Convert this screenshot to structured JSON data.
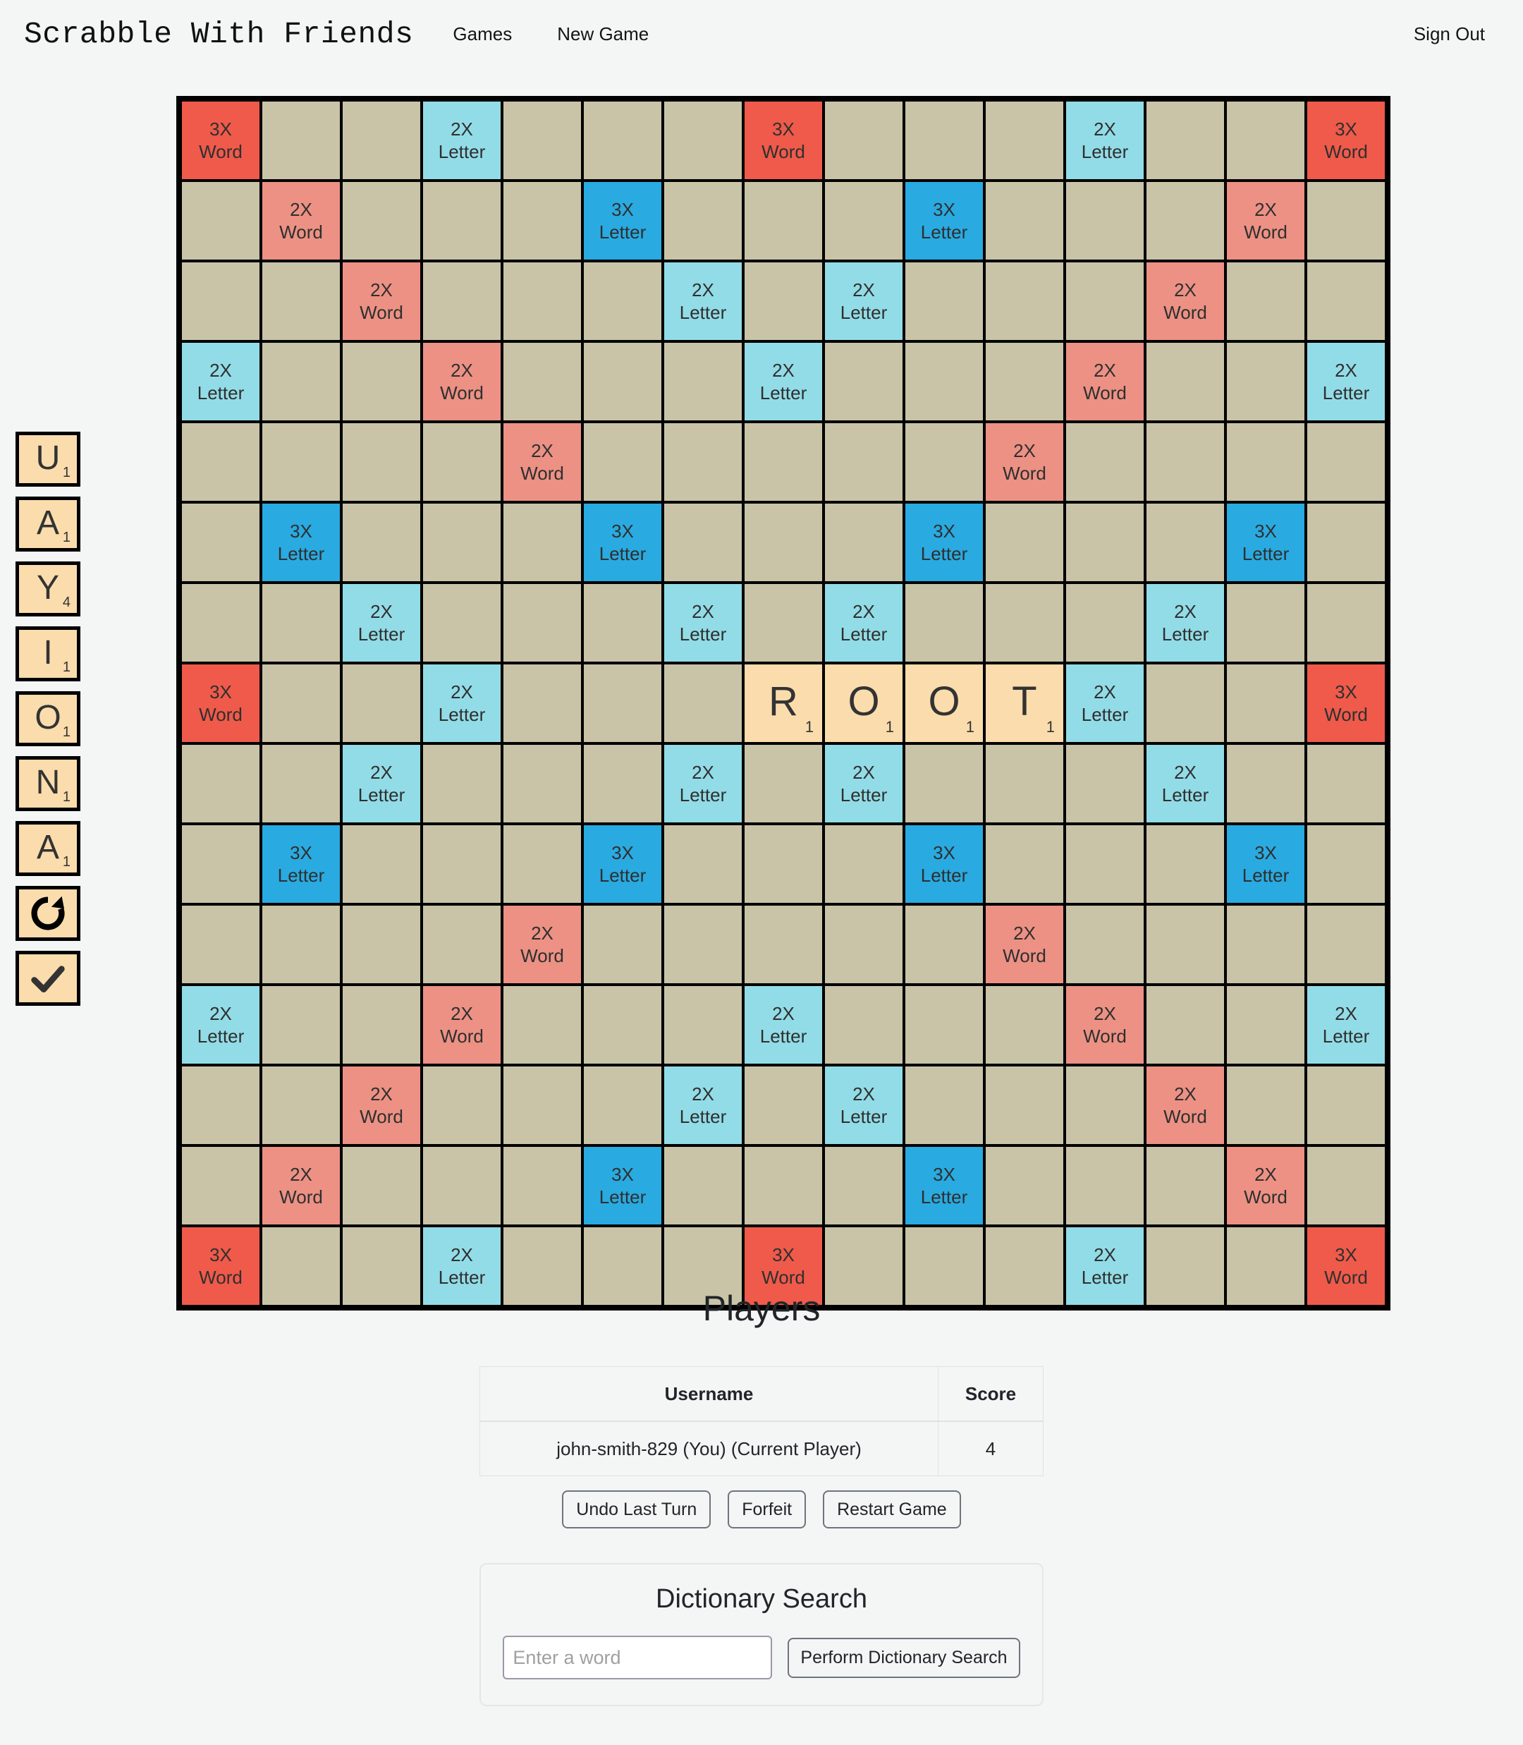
{
  "header": {
    "brand": "Scrabble With Friends",
    "nav": [
      {
        "label": "Games"
      },
      {
        "label": "New Game"
      }
    ],
    "sign_out": "Sign Out"
  },
  "colors": {
    "page_bg": "#f4f5f5",
    "board_grid": "#000000",
    "cell_normal": "#c9c4a8",
    "triple_word": "#ef5a4a",
    "double_word": "#ec9184",
    "triple_letter": "#29aae1",
    "double_letter": "#92dce7",
    "tile": "#fbdcac",
    "tile_text": "#333333"
  },
  "bonus_labels": {
    "tw": {
      "top": "3X",
      "bottom": "Word"
    },
    "dw": {
      "top": "2X",
      "bottom": "Word"
    },
    "tl": {
      "top": "3X",
      "bottom": "Letter"
    },
    "dl": {
      "top": "2X",
      "bottom": "Letter"
    }
  },
  "rack": {
    "tiles": [
      {
        "letter": "U",
        "value": "1"
      },
      {
        "letter": "A",
        "value": "1"
      },
      {
        "letter": "Y",
        "value": "4"
      },
      {
        "letter": "I",
        "value": "1"
      },
      {
        "letter": "O",
        "value": "1"
      },
      {
        "letter": "N",
        "value": "1"
      },
      {
        "letter": "A",
        "value": "1"
      }
    ],
    "actions": [
      {
        "icon": "refresh-icon",
        "name": "shuffle-tiles-button"
      },
      {
        "icon": "check-icon",
        "name": "submit-move-button"
      }
    ]
  },
  "board": {
    "size": 15,
    "cells": [
      [
        "tw",
        "",
        "",
        "dl",
        "",
        "",
        "",
        "tw",
        "",
        "",
        "",
        "dl",
        "",
        "",
        "tw"
      ],
      [
        "",
        "dw",
        "",
        "",
        "",
        "tl",
        "",
        "",
        "",
        "tl",
        "",
        "",
        "",
        "dw",
        ""
      ],
      [
        "",
        "",
        "dw",
        "",
        "",
        "",
        "dl",
        "",
        "dl",
        "",
        "",
        "",
        "dw",
        "",
        ""
      ],
      [
        "dl",
        "",
        "",
        "dw",
        "",
        "",
        "",
        "dl",
        "",
        "",
        "",
        "dw",
        "",
        "",
        "dl"
      ],
      [
        "",
        "",
        "",
        "",
        "dw",
        "",
        "",
        "",
        "",
        "",
        "dw",
        "",
        "",
        "",
        ""
      ],
      [
        "",
        "tl",
        "",
        "",
        "",
        "tl",
        "",
        "",
        "",
        "tl",
        "",
        "",
        "",
        "tl",
        ""
      ],
      [
        "",
        "",
        "dl",
        "",
        "",
        "",
        "dl",
        "",
        "dl",
        "",
        "",
        "",
        "dl",
        "",
        ""
      ],
      [
        "tw",
        "",
        "",
        "dl",
        "",
        "",
        "",
        "T:R:1",
        "T:O:1",
        "T:O:1",
        "T:T:1",
        "dl",
        "",
        "",
        "tw"
      ],
      [
        "",
        "",
        "dl",
        "",
        "",
        "",
        "dl",
        "",
        "dl",
        "",
        "",
        "",
        "dl",
        "",
        ""
      ],
      [
        "",
        "tl",
        "",
        "",
        "",
        "tl",
        "",
        "",
        "",
        "tl",
        "",
        "",
        "",
        "tl",
        ""
      ],
      [
        "",
        "",
        "",
        "",
        "dw",
        "",
        "",
        "",
        "",
        "",
        "dw",
        "",
        "",
        "",
        ""
      ],
      [
        "dl",
        "",
        "",
        "dw",
        "",
        "",
        "",
        "dl",
        "",
        "",
        "",
        "dw",
        "",
        "",
        "dl"
      ],
      [
        "",
        "",
        "dw",
        "",
        "",
        "",
        "dl",
        "",
        "dl",
        "",
        "",
        "",
        "dw",
        "",
        ""
      ],
      [
        "",
        "dw",
        "",
        "",
        "",
        "tl",
        "",
        "",
        "",
        "tl",
        "",
        "",
        "",
        "dw",
        ""
      ],
      [
        "tw",
        "",
        "",
        "dl",
        "",
        "",
        "",
        "tw",
        "",
        "",
        "",
        "dl",
        "",
        "",
        "tw"
      ]
    ],
    "placed_word": "ROOT"
  },
  "players": {
    "title": "Players",
    "columns": [
      "Username",
      "Score"
    ],
    "rows": [
      {
        "username": "john-smith-829 (You) (Current Player)",
        "score": "4"
      }
    ]
  },
  "game_actions": [
    {
      "label": "Undo Last Turn"
    },
    {
      "label": "Forfeit"
    },
    {
      "label": "Restart Game"
    }
  ],
  "dictionary": {
    "title": "Dictionary Search",
    "placeholder": "Enter a word",
    "input_value": "",
    "button_label": "Perform Dictionary Search"
  }
}
